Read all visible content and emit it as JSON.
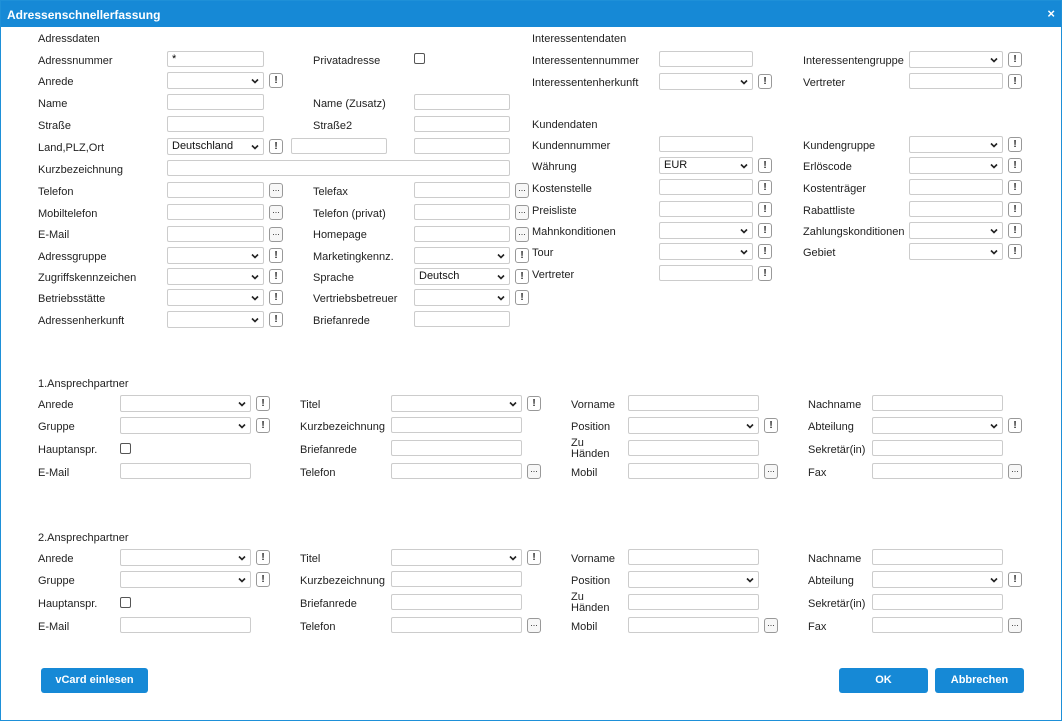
{
  "window": {
    "title": "Adressenschnellerfassung",
    "close_glyph": "×"
  },
  "sections": {
    "adressdaten": "Adressdaten",
    "interessentendaten": "Interessentendaten",
    "kundendaten": "Kundendaten",
    "ap1": "1.Ansprechpartner",
    "ap2": "2.Ansprechpartner"
  },
  "labels": {
    "adressnummer": "Adressnummer",
    "privatadresse": "Privatadresse",
    "anrede": "Anrede",
    "name": "Name",
    "name_zusatz": "Name (Zusatz)",
    "strasse": "Straße",
    "strasse2": "Straße2",
    "land_plz_ort": "Land,PLZ,Ort",
    "kurzbezeichnung": "Kurzbezeichnung",
    "telefon": "Telefon",
    "telefax": "Telefax",
    "mobiltelefon": "Mobiltelefon",
    "telefon_privat": "Telefon (privat)",
    "email": "E-Mail",
    "homepage": "Homepage",
    "adressgruppe": "Adressgruppe",
    "marketingkennz": "Marketingkennz.",
    "zugriffskennzeichen": "Zugriffskennzeichen",
    "sprache": "Sprache",
    "betriebsstaette": "Betriebsstätte",
    "vertriebsbetreuer": "Vertriebsbetreuer",
    "adressenherkunft": "Adressenherkunft",
    "briefanrede": "Briefanrede",
    "interessentennummer": "Interessentennummer",
    "interessentengruppe": "Interessentengruppe",
    "interessentenherkunft": "Interessentenherkunft",
    "vertreter": "Vertreter",
    "kundennummer": "Kundennummer",
    "kundengruppe": "Kundengruppe",
    "waehrung": "Währung",
    "erloescode": "Erlöscode",
    "kostenstelle": "Kostenstelle",
    "kostentraeger": "Kostenträger",
    "preisliste": "Preisliste",
    "rabattliste": "Rabattliste",
    "mahnkonditionen": "Mahnkonditionen",
    "zahlungskonditionen": "Zahlungskonditionen",
    "tour": "Tour",
    "gebiet": "Gebiet",
    "k_vertreter": "Vertreter"
  },
  "values": {
    "adressnummer": "*",
    "land": "Deutschland",
    "sprache": "Deutsch",
    "waehrung": "EUR"
  },
  "contact_labels": {
    "anrede": "Anrede",
    "titel": "Titel",
    "vorname": "Vorname",
    "nachname": "Nachname",
    "gruppe": "Gruppe",
    "kurzbezeichnung": "Kurzbezeichnung",
    "position": "Position",
    "abteilung": "Abteilung",
    "hauptanspr": "Hauptanspr.",
    "briefanrede": "Briefanrede",
    "zu_haenden": "Zu Händen",
    "sekretaer": "Sekretär(in)",
    "email": "E-Mail",
    "telefon": "Telefon",
    "mobil": "Mobil",
    "fax": "Fax"
  },
  "buttons": {
    "vcard": "vCard einlesen",
    "ok": "OK",
    "cancel": "Abbrechen",
    "exclamation": "!",
    "ellipsis": "..."
  },
  "colors": {
    "accent": "#1689d6"
  }
}
